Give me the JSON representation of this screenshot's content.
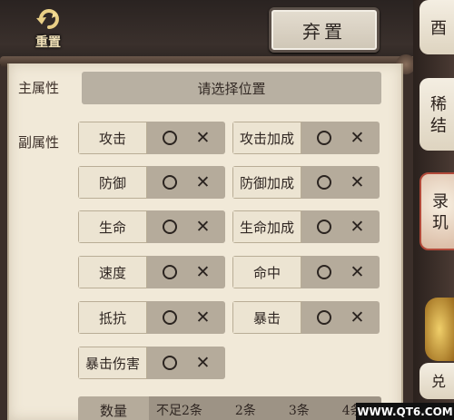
{
  "header": {
    "reset_label": "重置",
    "discard_label": "弃置"
  },
  "filters": {
    "main_attr_label": "主属性",
    "main_attr_placeholder": "请选择位置",
    "sub_attr_label": "副属性",
    "options": [
      {
        "name": "攻击"
      },
      {
        "name": "攻击加成"
      },
      {
        "name": "防御"
      },
      {
        "name": "防御加成"
      },
      {
        "name": "生命"
      },
      {
        "name": "生命加成"
      },
      {
        "name": "速度"
      },
      {
        "name": "命中"
      },
      {
        "name": "抵抗"
      },
      {
        "name": "暴击"
      },
      {
        "name": "暴击伤害"
      }
    ],
    "count_label": "数量",
    "count_values": [
      "不足2条",
      "2条",
      "3条",
      "4条"
    ]
  },
  "side_tabs": [
    "酉",
    "稀\n结",
    "录\n玑",
    "兑"
  ],
  "watermark": "WWW.QT6.COM"
}
